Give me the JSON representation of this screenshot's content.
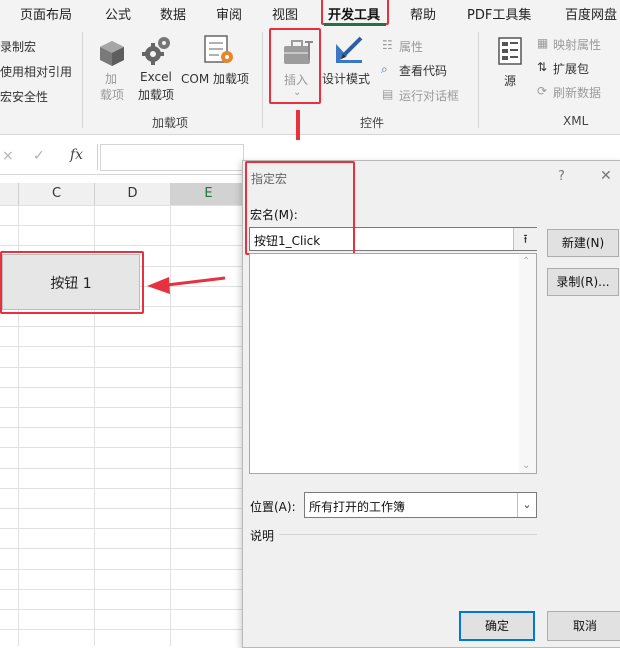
{
  "ribbon_tabs": [
    "页面布局",
    "公式",
    "数据",
    "审阅",
    "视图",
    "开发工具",
    "帮助",
    "PDF工具集",
    "百度网盘"
  ],
  "ribbon": {
    "code_group": {
      "record_macro": "录制宏",
      "relative_ref": "使用相对引用",
      "macro_security": "宏安全性"
    },
    "addins_group": {
      "addins_line1": "加",
      "addins_line2": "载项",
      "excel_line1": "Excel",
      "excel_line2": "加载项",
      "com_addins": "COM 加载项",
      "label": "加载项"
    },
    "controls_group": {
      "insert": "插入",
      "design_mode": "设计模式",
      "properties": "属性",
      "view_code": "查看代码",
      "run_dialog": "运行对话框",
      "label": "控件"
    },
    "xml_group": {
      "source": "源",
      "map_properties": "映射属性",
      "expansion_packs": "扩展包",
      "refresh_data": "刷新数据",
      "label": "XML"
    }
  },
  "formula_bar": {
    "cancel": "×",
    "enter": "✓",
    "fx": "fx"
  },
  "sheet": {
    "columns": [
      "C",
      "D",
      "E"
    ],
    "button_label": "按钮 1"
  },
  "dialog": {
    "title": "指定宏",
    "help": "?",
    "close": "✕",
    "macro_name_label": "宏名(M):",
    "macro_name_value": "按钮1_Click",
    "new_button": "新建(N)",
    "record_button": "录制(R)...",
    "location_label": "位置(A):",
    "location_value": "所有打开的工作簿",
    "description_label": "说明",
    "ok_button": "确定",
    "cancel_button": "取消"
  },
  "colors": {
    "highlight_red": "#e8313f",
    "dialog_bg": "#f0f0f0",
    "ok_border": "#0078d7"
  }
}
